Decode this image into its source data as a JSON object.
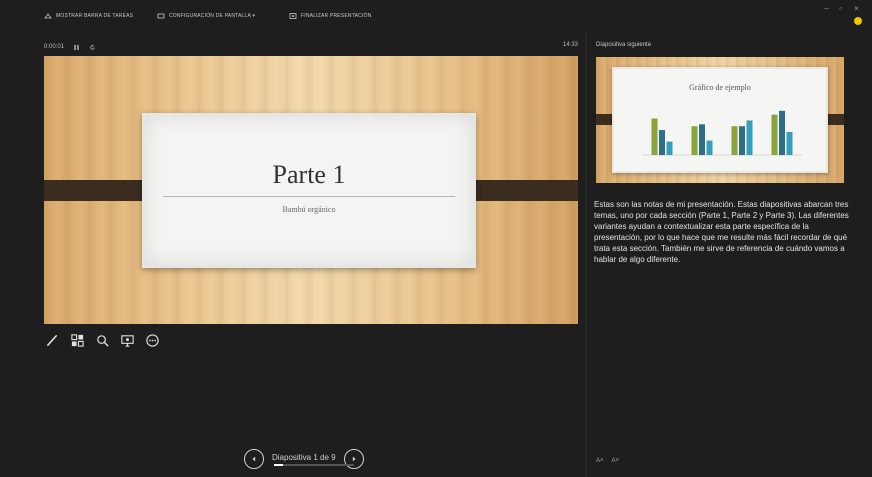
{
  "toolbar": {
    "taskbar_label": "MOSTRAR BARRA DE TAREAS",
    "display_settings_label": "CONFIGURACIÓN DE PANTALLA ▾",
    "end_show_label": "FINALIZAR PRESENTACIÓN"
  },
  "timer": {
    "elapsed": "0:00:01",
    "clock": "14:33"
  },
  "current_slide": {
    "title": "Parte 1",
    "subtitle": "Bambú orgánico"
  },
  "next_slide": {
    "header_label": "Diapositiva siguiente",
    "title": "Gráfico de ejemplo",
    "chart_data": {
      "type": "bar",
      "categories": [
        "",
        "",
        "",
        ""
      ],
      "series": [
        {
          "values": [
            3.8,
            3.0,
            3.0,
            4.2
          ],
          "color": "#8aa33a"
        },
        {
          "values": [
            2.6,
            3.2,
            3.0,
            4.6
          ],
          "color": "#2e6f88"
        },
        {
          "values": [
            1.4,
            1.5,
            3.6,
            2.4
          ],
          "color": "#37a0b8"
        }
      ],
      "ylim": [
        0,
        5
      ]
    }
  },
  "notes": "Estas son las notas de mi presentación. Estas diapositivas abarcan tres temas, uno por cada sección (Parte 1, Parte 2 y Parte 3). Las diferentes variantes ayudan a contextualizar esta parte específica de la presentación, por lo que hace que me resulte más fácil recordar de qué trata esta sección. También me sirve de referencia de cuándo vamos a hablar de algo diferente.",
  "navigator": {
    "label": "Diapositiva 1 de 9",
    "progress": 0.11
  },
  "icons": [
    "pen-icon",
    "see-all-slides-icon",
    "zoom-icon",
    "camera-icon",
    "more-options-icon"
  ],
  "colors": {
    "background": "#1e1e1e",
    "status_dot": "#f2c200",
    "slide_band": "#3b2c20"
  }
}
